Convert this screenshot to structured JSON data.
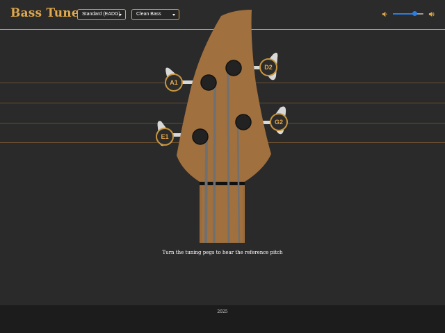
{
  "header": {
    "title": "Bass Tuner",
    "tuning_select": {
      "value": "Standard (EADG)"
    },
    "sound_select": {
      "value": "Clean Bass"
    },
    "volume": {
      "level": 0.72
    }
  },
  "pegs": [
    {
      "note": "A1"
    },
    {
      "note": "D2"
    },
    {
      "note": "E1"
    },
    {
      "note": "G2"
    }
  ],
  "instruction": "Turn the tuning pegs to hear the reference pitch",
  "footer": {
    "year": "2025"
  },
  "colors": {
    "background": "#2a2a2a",
    "accent": "#c8963e",
    "headstock": "#a0703f",
    "footer": "#1c1c1c",
    "slider": "#2a7de1"
  }
}
